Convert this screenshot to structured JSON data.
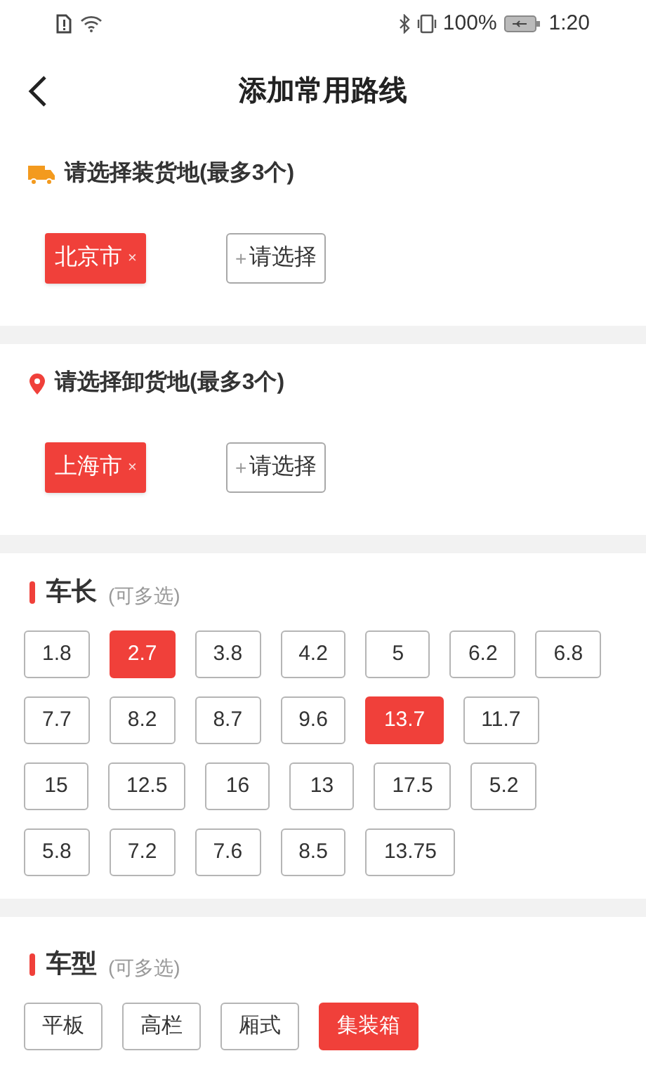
{
  "status_bar": {
    "battery": "100%",
    "time": "1:20"
  },
  "header": {
    "title": "添加常用路线"
  },
  "loading": {
    "title": "请选择装货地(最多3个)",
    "tags": [
      {
        "label": "北京市",
        "remove": "×"
      }
    ],
    "add": {
      "plus": "+",
      "label": "请选择"
    }
  },
  "unloading": {
    "title": "请选择卸货地(最多3个)",
    "tags": [
      {
        "label": "上海市",
        "remove": "×"
      }
    ],
    "add": {
      "plus": "+",
      "label": "请选择"
    }
  },
  "length": {
    "title": "车长",
    "hint": "(可多选)",
    "options": [
      {
        "label": "1.8",
        "selected": false
      },
      {
        "label": "2.7",
        "selected": true
      },
      {
        "label": "3.8",
        "selected": false
      },
      {
        "label": "4.2",
        "selected": false
      },
      {
        "label": "5",
        "selected": false
      },
      {
        "label": "6.2",
        "selected": false
      },
      {
        "label": "6.8",
        "selected": false
      },
      {
        "label": "7.7",
        "selected": false
      },
      {
        "label": "8.2",
        "selected": false
      },
      {
        "label": "8.7",
        "selected": false
      },
      {
        "label": "9.6",
        "selected": false
      },
      {
        "label": "13.7",
        "selected": true
      },
      {
        "label": "11.7",
        "selected": false
      },
      {
        "label": "15",
        "selected": false
      },
      {
        "label": "12.5",
        "selected": false
      },
      {
        "label": "16",
        "selected": false
      },
      {
        "label": "13",
        "selected": false
      },
      {
        "label": "17.5",
        "selected": false
      },
      {
        "label": "5.2",
        "selected": false
      },
      {
        "label": "5.8",
        "selected": false
      },
      {
        "label": "7.2",
        "selected": false
      },
      {
        "label": "7.6",
        "selected": false
      },
      {
        "label": "8.5",
        "selected": false
      },
      {
        "label": "13.75",
        "selected": false
      }
    ]
  },
  "type": {
    "title": "车型",
    "hint": "(可多选)",
    "options": [
      {
        "label": "平板",
        "selected": false
      },
      {
        "label": "高栏",
        "selected": false
      },
      {
        "label": "厢式",
        "selected": false
      },
      {
        "label": "集装箱",
        "selected": true
      }
    ]
  }
}
